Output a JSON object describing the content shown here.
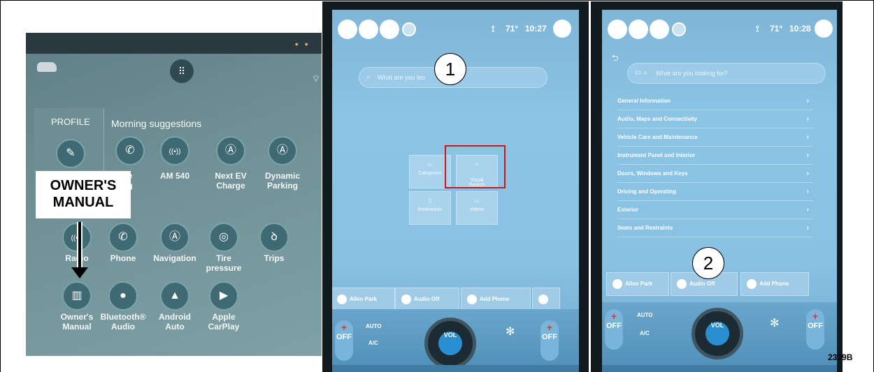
{
  "panel1": {
    "profile_label": "PROFILE",
    "section_title": "Morning suggestions",
    "suggestions": [
      {
        "icon": "phone-icon",
        "glyph": "✆",
        "label": "e\ng"
      },
      {
        "icon": "radio-icon",
        "glyph": "((•))",
        "label": "AM 540"
      },
      {
        "icon": "navigation-icon",
        "glyph": "Ⓐ",
        "label": "Next EV\nCharge"
      },
      {
        "icon": "navigation-icon",
        "glyph": "Ⓐ",
        "label": "Dynamic\nParking"
      }
    ],
    "apps_row1": [
      {
        "icon": "radio-icon",
        "glyph": "((•))",
        "label": "Radio"
      },
      {
        "icon": "phone-icon",
        "glyph": "✆",
        "label": "Phone"
      },
      {
        "icon": "navigation-icon",
        "glyph": "Ⓐ",
        "label": "Navigation"
      },
      {
        "icon": "tire-icon",
        "glyph": "◎",
        "label": "Tire\npressure"
      },
      {
        "icon": "trips-icon",
        "glyph": "ꝺ",
        "label": "Trips"
      }
    ],
    "apps_row2": [
      {
        "icon": "book-icon",
        "glyph": "▥",
        "label": "Owner's\nManual"
      },
      {
        "icon": "bluetooth-icon",
        "glyph": "●",
        "label": "Bluetooth®\nAudio"
      },
      {
        "icon": "android-auto-icon",
        "glyph": "▲",
        "label": "Android\nAuto"
      },
      {
        "icon": "carplay-icon",
        "glyph": "▶",
        "label": "Apple\nCarPlay"
      }
    ],
    "callout": "OWNER'S\nMANUAL"
  },
  "panel2": {
    "temp": "71°",
    "time": "10:27",
    "search_placeholder": "What are you loo",
    "step": "1",
    "tiles": [
      {
        "icon": "categories-icon",
        "label": "Categories"
      },
      {
        "icon": "visual-search-icon",
        "label": "Visual\nSearch"
      },
      {
        "icon": "bookmarks-icon",
        "label": "Bookmarks"
      },
      {
        "icon": "videos-icon",
        "label": "Videos"
      }
    ],
    "bottom_chips": [
      "Allen Park",
      "Audio Off",
      "Add Phone"
    ],
    "climate": {
      "off": "OFF",
      "auto": "AUTO",
      "ac": "A/C",
      "vol": "VOL"
    }
  },
  "panel3": {
    "temp": "71°",
    "time": "10:28",
    "search_placeholder": "What are you looking for?",
    "list": [
      "General Information",
      "Audio, Maps and Connectivity",
      "Vehicle Care and Maintenance",
      "Instrument Panel and Interior",
      "Doors, Windows and Keys",
      "Driving and Operating",
      "Exterior",
      "Seats and Restraints"
    ],
    "step": "2",
    "bottom_chips": [
      "Allen Park",
      "Audio Off",
      "Add Phone"
    ],
    "climate": {
      "off": "OFF",
      "auto": "AUTO",
      "ac": "A/C",
      "vol": "VOL"
    }
  },
  "figure_code": "2339B"
}
